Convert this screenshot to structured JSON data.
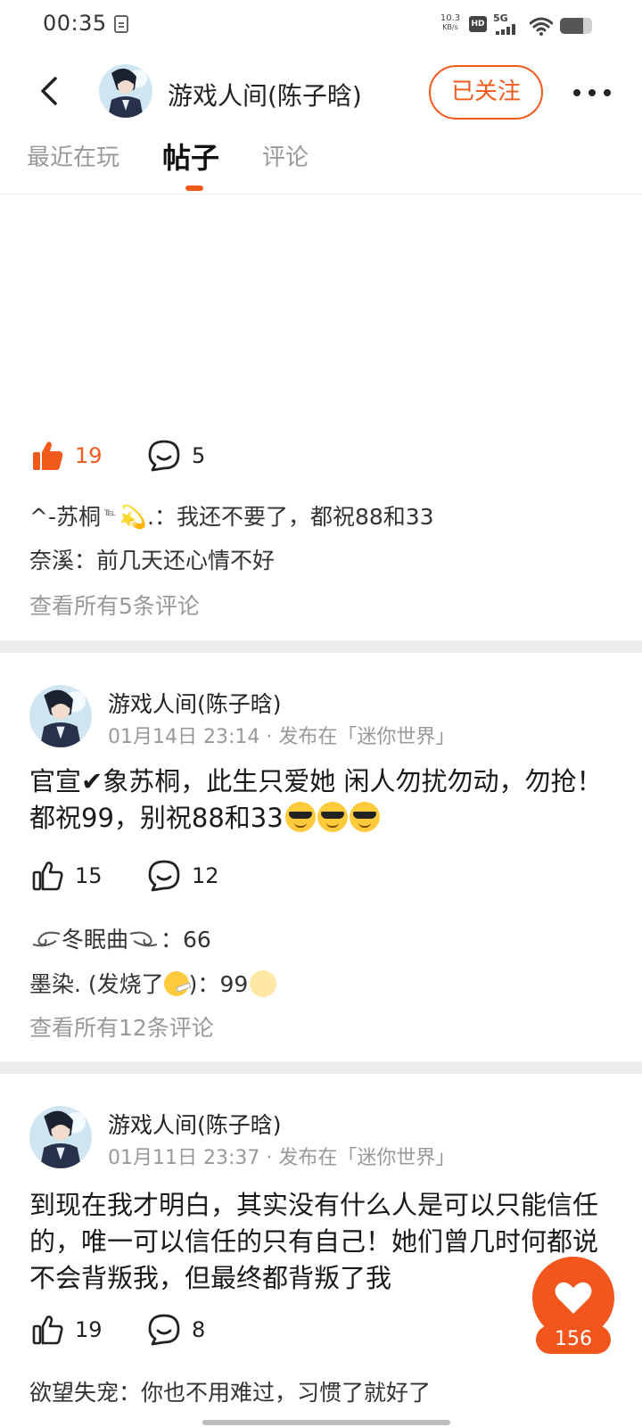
{
  "status_bar": {
    "time": "00:35",
    "net_speed_value": "10.3",
    "net_speed_unit": "KB/s",
    "hd_label": "HD",
    "network_type": "5G",
    "battery_level": 0.72
  },
  "header": {
    "name": "游戏人间(陈子晗)",
    "follow_label": "已关注"
  },
  "tabs": [
    {
      "label": "最近在玩"
    },
    {
      "label": "帖子",
      "active": true
    },
    {
      "label": "评论"
    }
  ],
  "posts": [
    {
      "likes": "19",
      "liked": true,
      "comments": "5",
      "preview_comments": [
        {
          "user": "^-苏桐",
          "tel": "℡",
          "suffix": "💫.",
          "text": "我还不要了，都祝88和33"
        },
        {
          "user": "奈溪",
          "text": "前几天还心情不好"
        }
      ],
      "view_all": "查看所有5条评论"
    },
    {
      "author": "游戏人间(陈子晗)",
      "meta": "01月14日 23:14 · 发布在「迷你世界」",
      "body": "官宣✔象苏桐，此生只爱她 闲人勿扰勿动，勿抢！都祝99，别祝88和33",
      "likes": "15",
      "comments": "12",
      "preview_comments": [
        {
          "user": "冬眠曲",
          "text": "66"
        },
        {
          "user": "墨染. (发烧了",
          "user_end": ")",
          "text": "99"
        }
      ],
      "view_all": "查看所有12条评论"
    },
    {
      "author": "游戏人间(陈子晗)",
      "meta": "01月11日 23:37 · 发布在「迷你世界」",
      "body": "到现在我才明白，其实没有什么人是可以只能信任的，唯一可以信任的只有自己！她们曾几时何都说不会背叛我，但最终都背叛了我",
      "likes": "19",
      "comments": "8",
      "preview_comments": [
        {
          "user": "欲望失宠",
          "text": "你也不用难过，习惯了就好了"
        }
      ]
    }
  ],
  "floating_like": {
    "count": "156"
  },
  "colors": {
    "accent": "#f25a1c",
    "muted": "#999999",
    "divider": "#ececec"
  },
  "icons": [
    "back-arrow-icon",
    "more-dots-icon",
    "thumbs-up-icon",
    "comment-bubble-icon",
    "heart-icon",
    "wifi-icon",
    "battery-icon",
    "signal-icon"
  ]
}
